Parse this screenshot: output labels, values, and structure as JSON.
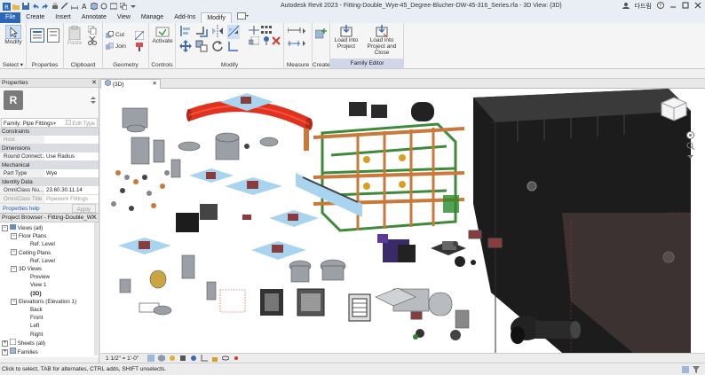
{
  "app": {
    "title": "Autodesk Revit 2023 - Fitting-Double_Wye-45_Degree-Blucher-DW-45-316_Series.rfa - 3D View: {3D}",
    "user": "다드림"
  },
  "tabs": [
    "File",
    "Create",
    "Insert",
    "Annotate",
    "View",
    "Manage",
    "Add-Ins",
    "Modify"
  ],
  "ribbon": {
    "modify_label": "Modify",
    "select_label": "Select ▾",
    "properties_label": "Properties",
    "clipboard_label": "Clipboard",
    "paste_label": "Paste",
    "cut_label": "Cut",
    "join_label": "Join",
    "geometry_label": "Geometry",
    "activate_label": "Activate",
    "controls_label": "Controls",
    "modify_panel_label": "Modify",
    "measure_label": "Measure",
    "create_label": "Create",
    "load_into_project": "Load into Project",
    "load_into_project_close": "Load into Project and Close",
    "family_editor_label": "Family Editor"
  },
  "properties": {
    "title": "Properties",
    "family_label": "Family: Pipe Fittings",
    "edit_type": "Edit Type",
    "groups": {
      "constraints": "Constraints",
      "dimensions": "Dimensions",
      "mechanical": "Mechanical",
      "identity": "Identity Data"
    },
    "rows": {
      "host": {
        "k": "Host",
        "v": ""
      },
      "round_connect": {
        "k": "Round Connect...",
        "v": "Use Radius"
      },
      "part_type": {
        "k": "Part Type",
        "v": "Wye"
      },
      "omniclass_num": {
        "k": "OmniClass Nu...",
        "v": "23.60.30.11.14"
      },
      "omniclass_title": {
        "k": "OmniClass Title",
        "v": "Pipework Fittings"
      }
    },
    "help_link": "Properties help",
    "apply": "Apply"
  },
  "browser": {
    "title": "Project Browser - Fitting-Double_W...",
    "nodes": {
      "views_all": "Views (all)",
      "floor_plans": "Floor Plans",
      "ref_level_1": "Ref. Level",
      "ceiling_plans": "Ceiling Plans",
      "ref_level_2": "Ref. Level",
      "views_3d": "3D Views",
      "preview": "Preview",
      "view1": "View 1",
      "view_3d": "{3D}",
      "elevations": "Elevations (Elevation 1)",
      "back": "Back",
      "front": "Front",
      "left": "Left",
      "right": "Right",
      "sheets": "Sheets (all)",
      "families": "Families"
    }
  },
  "view": {
    "tab_label": "{3D}",
    "scale": "1 1/2\" = 1'-0\""
  },
  "status": {
    "message": "Click to select, TAB for alternates, CTRL adds, SHIFT unselects."
  },
  "colors": {
    "accent": "#2a67b8",
    "pipe_red": "#e0321e",
    "copper": "#c97a3a",
    "frame_green": "#3f8a3a",
    "tank": "#1c1c1c"
  }
}
